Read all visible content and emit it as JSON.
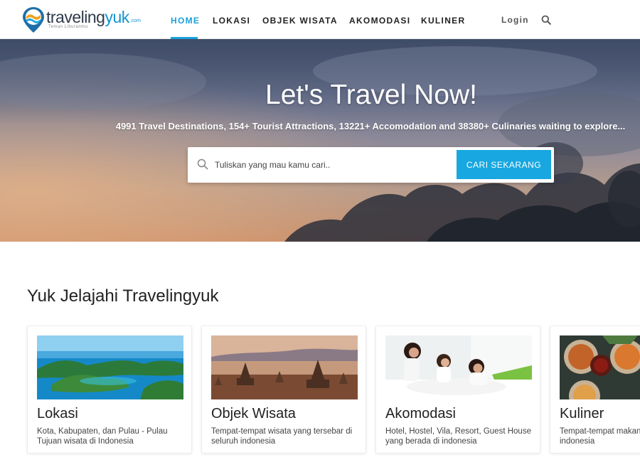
{
  "brand": {
    "name_part1": "traveling",
    "name_part2": "yuk",
    "domain_suffix": ".com",
    "tagline": "Teman Liburanmu",
    "primary_color": "#1aa0dc"
  },
  "nav": {
    "items": [
      {
        "label": "HOME",
        "active": true
      },
      {
        "label": "LOKASI",
        "active": false
      },
      {
        "label": "OBJEK WISATA",
        "active": false
      },
      {
        "label": "AKOMODASI",
        "active": false
      },
      {
        "label": "KULINER",
        "active": false
      }
    ],
    "login_label": "Login",
    "search_icon": "search-icon"
  },
  "hero": {
    "title": "Let's Travel Now!",
    "subtitle": "4991 Travel Destinations, 154+ Tourist Attractions, 13221+ Accomodation and 38380+ Culinaries waiting to explore...",
    "search": {
      "placeholder": "Tuliskan yang mau kamu cari..",
      "value": "",
      "button_label": "CARI SEKARANG",
      "icon": "search-icon"
    }
  },
  "section": {
    "title": "Yuk Jelajahi Travelingyuk",
    "cards": [
      {
        "title": "Lokasi",
        "description": "Kota, Kabupaten, dan Pulau - Pulau Tujuan wisata di Indonesia"
      },
      {
        "title": "Objek Wisata",
        "description": "Tempat-tempat wisata yang tersebar di seluruh indonesia"
      },
      {
        "title": "Akomodasi",
        "description": "Hotel, Hostel, Vila, Resort, Guest House yang berada di indonesia"
      },
      {
        "title": "Kuliner",
        "description": "Tempat-tempat makan khas di seluruh indonesia"
      }
    ]
  }
}
